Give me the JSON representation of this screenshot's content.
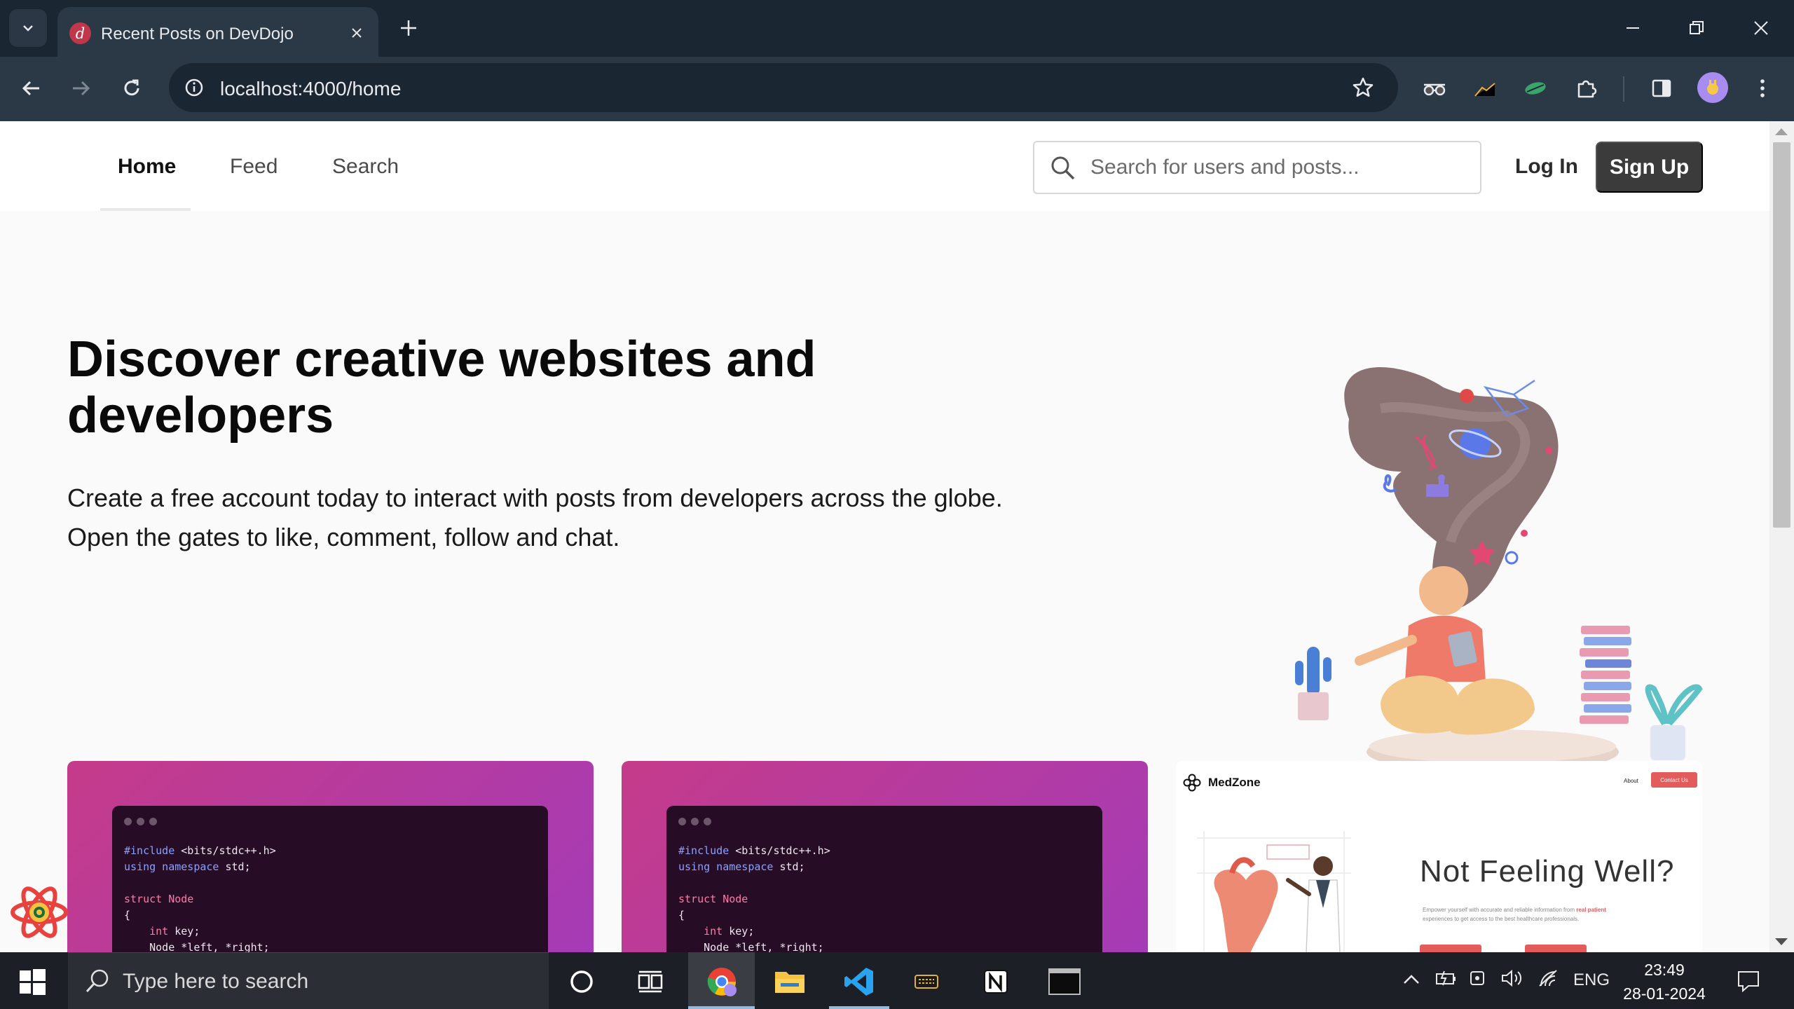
{
  "browser": {
    "tab_title": "Recent Posts on DevDojo",
    "tab_favicon_letter": "d",
    "url": "localhost:4000/home"
  },
  "site": {
    "nav": {
      "home": "Home",
      "feed": "Feed",
      "search": "Search"
    },
    "search_placeholder": "Search for users and posts...",
    "login": "Log In",
    "signup": "Sign Up"
  },
  "hero": {
    "title": "Discover creative websites and developers",
    "description": "Create a free account today to interact with posts from developers across the globe. Open the gates to like, comment, follow and chat."
  },
  "cards": {
    "code_lines": {
      "l1a": "#include",
      "l1b": " <bits/stdc++.h>",
      "l2a": "using namespace",
      "l2b": " std;",
      "l3a": "struct",
      "l3b": " Node",
      "l4": "{",
      "l5a": "    int",
      "l5b": " key;",
      "l6": "    Node *left, *right;"
    },
    "medzone": {
      "brand": "MedZone",
      "about": "About",
      "contact": "Contact Us",
      "headline": "Not Feeling Well?",
      "sub_text": "Empower yourself with accurate and reliable information from",
      "sub_highlight": "real patient",
      "sub_text2": "experiences to get access to the best healthcare professionals."
    }
  },
  "taskbar": {
    "search_placeholder": "Type here to search",
    "language": "ENG",
    "time": "23:49",
    "date": "28-01-2024"
  },
  "colors": {
    "browser_dark": "#1b2633",
    "browser_toolbar": "#2b3845",
    "signup_bg": "#3b3b3b",
    "card_gradient_start": "#c53b8a",
    "card_gradient_end": "#a43bb8",
    "medzone_accent": "#e25c5c"
  }
}
